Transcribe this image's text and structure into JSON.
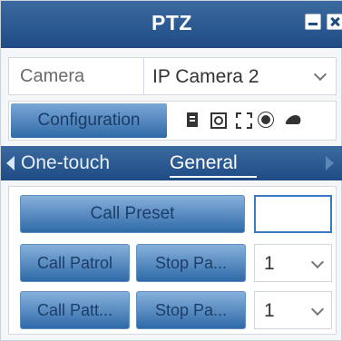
{
  "window": {
    "title": "PTZ",
    "accent": "#1e4b84"
  },
  "camera": {
    "label": "Camera",
    "selected": "IP Camera 2"
  },
  "toolbar": {
    "configuration_label": "Configuration",
    "icons": [
      "preset-list-icon",
      "zoom-icon",
      "focus-icon",
      "light-icon",
      "wiper-icon"
    ]
  },
  "tabs": [
    {
      "label": "One-touch",
      "active": false
    },
    {
      "label": "General",
      "active": true
    }
  ],
  "general": {
    "call_preset_label": "Call Preset",
    "preset_value": "",
    "call_patrol_label": "Call Patrol",
    "stop_patrol_label": "Stop Pa...",
    "patrol_select": "1",
    "call_pattern_label": "Call Patt...",
    "stop_pattern_label": "Stop Pa...",
    "pattern_select": "1"
  }
}
